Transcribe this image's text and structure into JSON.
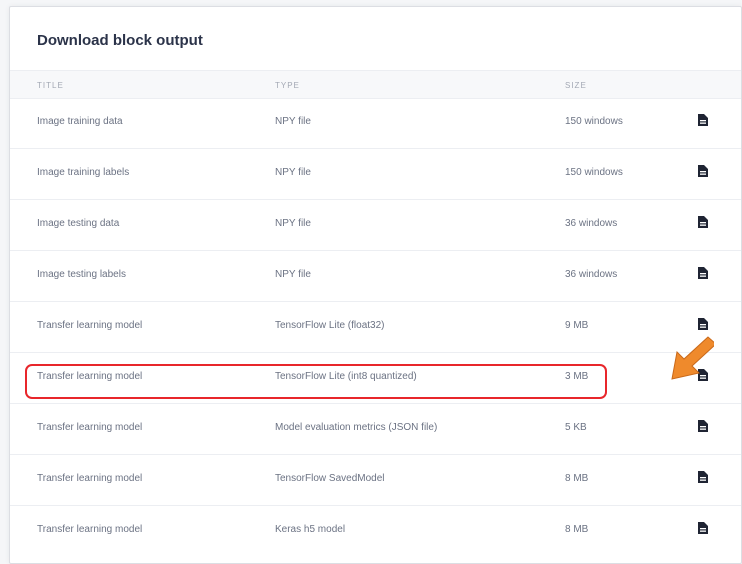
{
  "panel": {
    "title": "Download block output",
    "columns": {
      "title": "TITLE",
      "type": "TYPE",
      "size": "SIZE"
    },
    "rows": [
      {
        "title": "Image training data",
        "type": "NPY file",
        "size": "150 windows",
        "download_icon": "download-file-icon"
      },
      {
        "title": "Image training labels",
        "type": "NPY file",
        "size": "150 windows",
        "download_icon": "download-file-icon"
      },
      {
        "title": "Image testing data",
        "type": "NPY file",
        "size": "36 windows",
        "download_icon": "download-file-icon"
      },
      {
        "title": "Image testing labels",
        "type": "NPY file",
        "size": "36 windows",
        "download_icon": "download-file-icon"
      },
      {
        "title": "Transfer learning model",
        "type": "TensorFlow Lite (float32)",
        "size": "9 MB",
        "download_icon": "download-file-icon"
      },
      {
        "title": "Transfer learning model",
        "type": "TensorFlow Lite (int8 quantized)",
        "size": "3 MB",
        "download_icon": "download-file-icon"
      },
      {
        "title": "Transfer learning model",
        "type": "Model evaluation metrics (JSON file)",
        "size": "5 KB",
        "download_icon": "download-file-icon"
      },
      {
        "title": "Transfer learning model",
        "type": "TensorFlow SavedModel",
        "size": "8 MB",
        "download_icon": "download-file-icon"
      },
      {
        "title": "Transfer learning model",
        "type": "Keras h5 model",
        "size": "8 MB",
        "download_icon": "download-file-icon"
      }
    ]
  },
  "annotation": {
    "highlighted_row_index": 5,
    "highlight_color": "#e8262b",
    "arrow_color": "#ef8a2c"
  }
}
